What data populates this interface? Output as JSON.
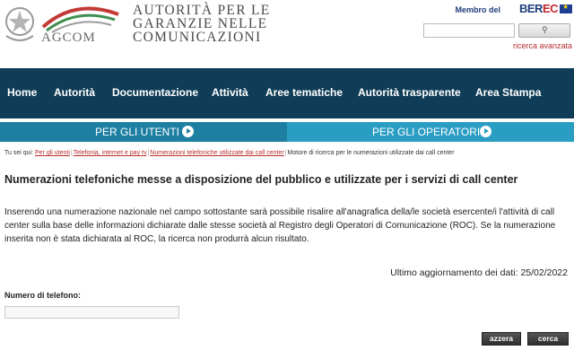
{
  "header": {
    "logo_wordmark": "AGCOM",
    "authority_name_lines": [
      "AUTORITÀ PER LE",
      "GARANZIE NELLE",
      "COMUNICAZIONI"
    ],
    "member_of": "Membro del",
    "berec_prefix": "BER",
    "berec_suffix": "EC",
    "search": {
      "placeholder": "",
      "button_icon": "magnifier-icon"
    },
    "advanced_search": "ricerca avanzata"
  },
  "nav": {
    "items": [
      "Home",
      "Autorità",
      "Documentazione",
      "Attività",
      "Aree tematiche",
      "Autorità trasparente",
      "Area Stampa"
    ]
  },
  "subbar": {
    "users": "PER GLI UTENTI",
    "operators": "PER GLI OPERATORI"
  },
  "breadcrumb": {
    "prefix": "Tu sei qui:",
    "links": [
      "Per gli utenti",
      "Telefonia, internet e pay tv",
      "Numerazioni telefoniche utilizzate dai call center"
    ],
    "current": "Motore di ricerca per le numerazioni utilizzate dai call center"
  },
  "main": {
    "title": "Numerazioni telefoniche messe a disposizione del pubblico e utilizzate per i servizi di call center",
    "description": "Inserendo una numerazione nazionale nel campo sottostante sarà possibile risalire all'anagrafica della/le società esercente/i l'attività di call center sulla base delle informazioni dichiarate dalle stesse società al Registro degli Operatori di Comunicazione (ROC). Se la numerazione inserita non è stata dichiarata al ROC, la ricerca non produrrà alcun risultato.",
    "last_update": "Ultimo aggiornamento dei dati: 25/02/2022",
    "phone_label": "Numero di telefono:",
    "phone_value": "",
    "reset_label": "azzera",
    "search_label": "cerca"
  },
  "colors": {
    "navbar": "#0f3d57",
    "subbar_users": "#1d7fa2",
    "subbar_operators": "#2a9dc3",
    "link_red": "#b72c2c",
    "berec_blue": "#1f3d7a"
  }
}
